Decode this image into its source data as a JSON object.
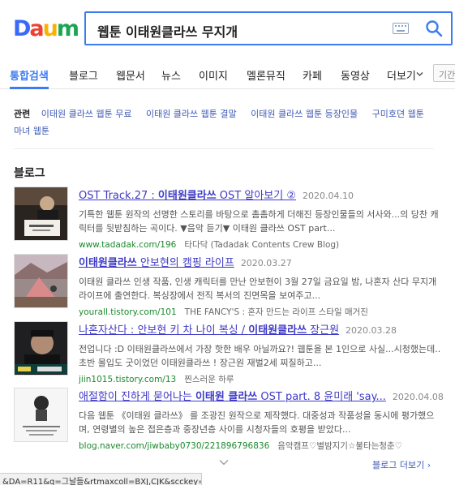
{
  "logo": {
    "letters": [
      "D",
      "a",
      "u",
      "m"
    ],
    "colors": [
      "#3b6bf6",
      "#ea4335",
      "#f9b200",
      "#1ba555"
    ]
  },
  "search": {
    "query": "웹툰 이태원클라쓰 무지개",
    "keyboard_icon": "keyboard-icon",
    "button_icon": "search-icon"
  },
  "tabs": {
    "items": [
      {
        "label": "통합검색",
        "active": true
      },
      {
        "label": "블로그"
      },
      {
        "label": "웹문서"
      },
      {
        "label": "뉴스"
      },
      {
        "label": "이미지"
      },
      {
        "label": "멜론뮤직"
      },
      {
        "label": "카페"
      },
      {
        "label": "동영상"
      },
      {
        "label": "더보기"
      }
    ],
    "extra_input": "기간"
  },
  "related": {
    "label": "관련",
    "links": [
      "이태원 클라쓰 웹툰 무료",
      "이태원 클라쓰 웹툰 결말",
      "이태원 클라쓰 웹툰 등장인물",
      "구미호뎐 웹툰",
      "마녀 웹툰"
    ]
  },
  "section_title": "블로그",
  "results": [
    {
      "title_pre": "OST Track.27 : ",
      "title_hl": "이태원클라쓰",
      "title_post": " OST 알아보기 ②",
      "date": "2020.04.10",
      "snippet": "기특한 웹툰 원작의 선명한 스토리를 바탕으로 촘촘하게 더해진 등장인물들의 서사와...의 당찬 캐릭터를 뒷받침하는 곡이다. ▼음악 듣기▼ 이태원 클라쓰 OST part...",
      "url": "www.tadadak.com/196",
      "source": "타다닥 (Tadadak Contents Crew Blog)"
    },
    {
      "title_pre": "",
      "title_hl": "이태원클라쓰",
      "title_post": " 안보현의 캠핑 라이프",
      "date": "2020.03.27",
      "snippet": "이태원 클라쓰 인생 작품, 인생 캐릭터를 만난 안보현이 3월 27일 금요일 밤, 나혼자 산다 무지개 라이프에 출연한다. 복싱장에서 전직 복서의 진면목을 보여주고...",
      "url": "yourall.tistory.com/101",
      "source": "THE FANCY'S : 혼자 만드는 라이프 스타일 매거진"
    },
    {
      "title_pre": "나혼자산다 : 안보현 키 차 나이 복싱 / ",
      "title_hl": "이태원클라쓰",
      "title_post": " 장근원",
      "date": "2020.03.28",
      "snippet": "전업니다 :D 이태원클라쓰에서 가장 핫한 배우 아닐까요?! 웹툰을 본 1인으로 사실...시청했는데.. 초반 몰입도 굿이었던 이태원클라쓰 ! 장근원 재벌2세 찌질하고...",
      "url": "jiin1015.tistory.com/13",
      "source": "찐스러운 하루"
    },
    {
      "title_pre": "애절함이 진하게 묻어나는 ",
      "title_hl": "이태원 클라쓰",
      "title_post": " OST part. 8 윤미래 'say...",
      "date": "2020.04.08",
      "snippet": "다음 웹툰 《이태원 클라쓰》 를 조광진 원작으로 제작했다. 대중성과 작품성을 동시에 평가했으며, 연령별의 높은 접은층과 중장년층 사이를 시청자들의 호평을 받았다...",
      "url": "blog.naver.com/jiwbaby0730/221896796836",
      "source": "음악캠프♡별밤지기☆불타는청춘♡"
    }
  ],
  "more_label": "블로그 더보기 ›",
  "status_bar": "&DA=R11&q=그날들&rtmaxcoll=BXJ,CJK&scckey=P..."
}
